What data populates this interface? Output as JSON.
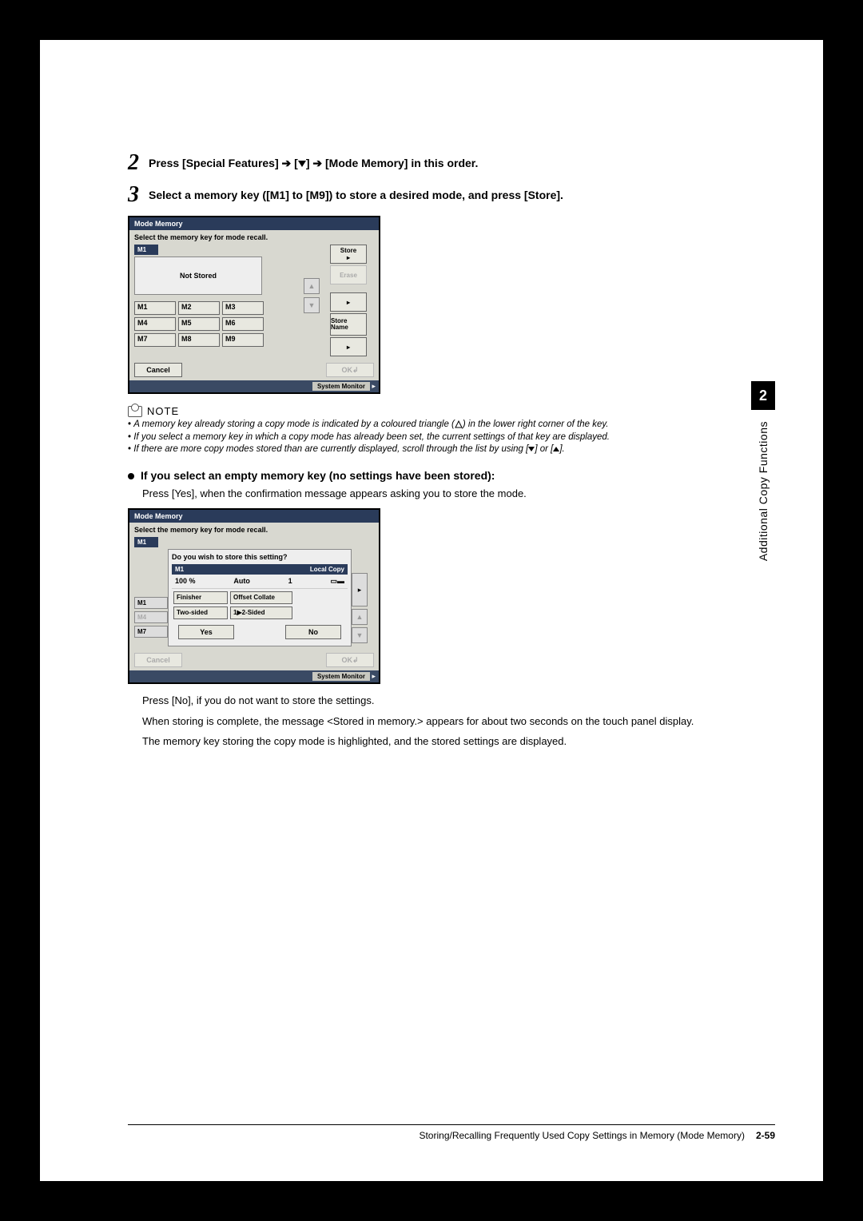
{
  "step2": {
    "num": "2",
    "prefix": "Press [Special Features] ",
    "mid": " [",
    "after_tri": "] ",
    "suffix": " [Mode Memory] in this order."
  },
  "step3": {
    "num": "3",
    "text": "Select a memory key ([M1] to [M9]) to store a desired mode, and press [Store]."
  },
  "screenshot1": {
    "title": "Mode Memory",
    "subtitle": "Select the memory key for mode recall.",
    "selected": "M1",
    "preview": "Not Stored",
    "keys": [
      "M1",
      "M2",
      "M3",
      "M4",
      "M5",
      "M6",
      "M7",
      "M8",
      "M9"
    ],
    "store": "Store",
    "erase": "Erase",
    "store_name": "Store Name",
    "cancel": "Cancel",
    "ok": "OK",
    "system_monitor": "System Monitor"
  },
  "note": {
    "label": "NOTE",
    "items": [
      "A memory key already storing a copy mode is indicated by a coloured triangle (",
      ") in the lower right corner of the key.",
      "If you select a memory key in which a copy mode has already been set, the current settings of that key are displayed.",
      "If there are more copy modes stored than are currently displayed, scroll through the list by using [",
      "] or [",
      "]."
    ]
  },
  "bullet": {
    "heading": "If you select an empty memory key (no settings have been stored):",
    "p1": "Press [Yes], when the confirmation message appears asking you to store the mode."
  },
  "screenshot2": {
    "title": "Mode Memory",
    "subtitle": "Select the memory key for mode recall.",
    "selected": "M1",
    "dialog_title": "Do you wish to store this setting?",
    "m1_label": "M1",
    "local_copy": "Local Copy",
    "ratio": "100 %",
    "auto": "Auto",
    "count": "1",
    "options": [
      "Finisher",
      "Offset Collate",
      "Two-sided",
      "1▶2-Sided"
    ],
    "left_keys": [
      "M1",
      "M4",
      "M7"
    ],
    "yes": "Yes",
    "no": "No",
    "cancel": "Cancel",
    "ok": "OK",
    "system_monitor": "System Monitor"
  },
  "after": {
    "p1": "Press [No], if you do not want to store the settings.",
    "p2": "When storing is complete, the message <Stored in memory.> appears for about two seconds on the touch panel display.",
    "p3": "The memory key storing the copy mode is highlighted, and the stored settings are displayed."
  },
  "sidebar": {
    "num": "2",
    "label": "Additional Copy Functions"
  },
  "footer": {
    "text": "Storing/Recalling Frequently Used Copy Settings in Memory (Mode Memory)",
    "page": "2-59"
  }
}
